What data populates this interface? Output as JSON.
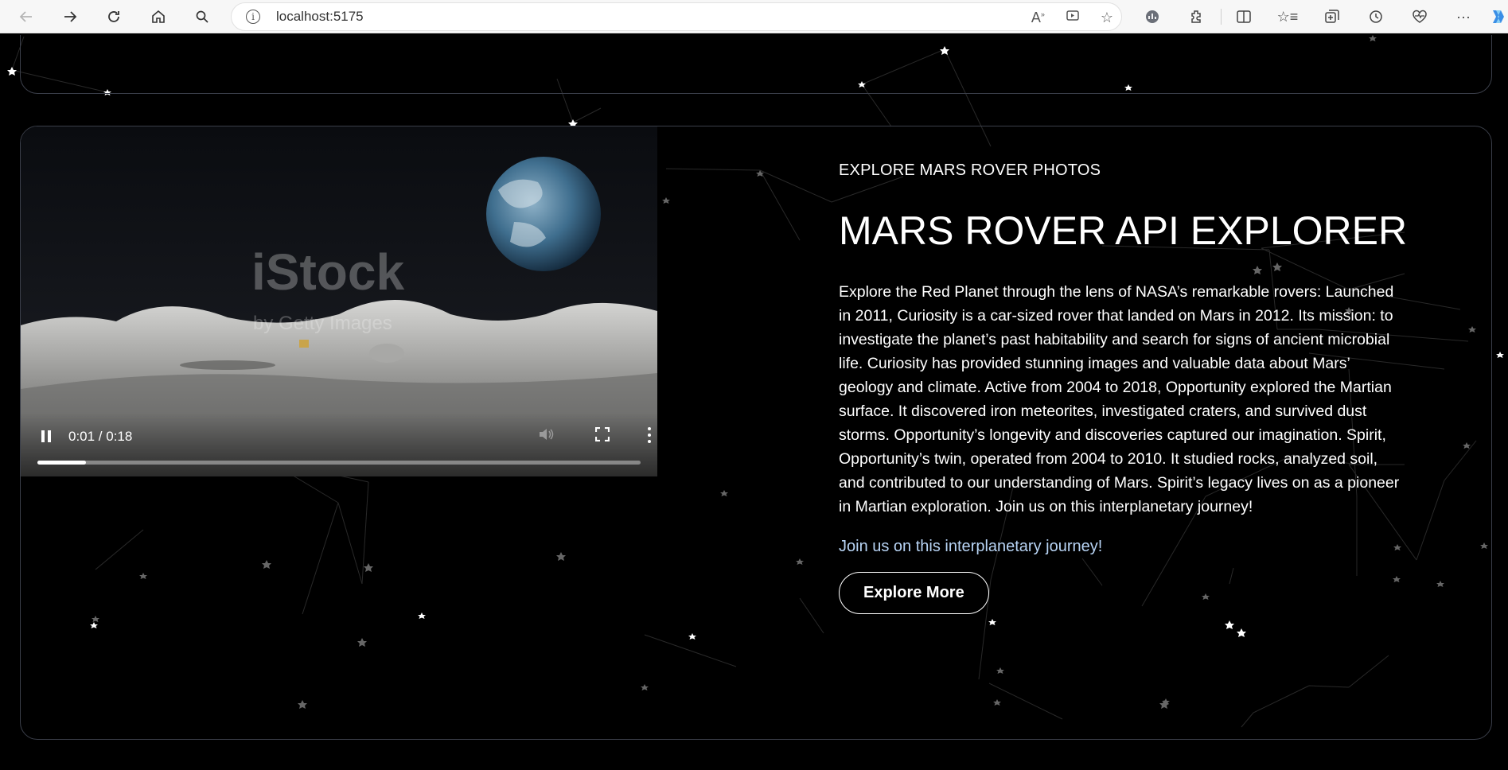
{
  "browser": {
    "url": "localhost:5175",
    "icons": [
      "back-icon",
      "forward-icon",
      "reload-icon",
      "home-icon",
      "search-icon",
      "site-info-icon",
      "read-aloud-icon",
      "immersive-reader-icon",
      "favorite-star-icon",
      "browser-essentials-icon",
      "extensions-icon",
      "split-screen-icon",
      "favorites-icon",
      "collections-icon",
      "history-icon",
      "performance-icon",
      "more-menu-icon",
      "copilot-icon"
    ]
  },
  "video": {
    "current_time": "0:01",
    "duration": "0:18",
    "time_display": "0:01 / 0:18",
    "progress": 0.08,
    "watermark": "iStock by Getty Images",
    "playing": true
  },
  "hero": {
    "eyebrow": "EXPLORE MARS ROVER PHOTOS",
    "title": "MARS ROVER API EXPLORER",
    "description": "Explore the Red Planet through the lens of NASA’s remarkable rovers: Launched in 2011, Curiosity is a car-sized rover that landed on Mars in 2012. Its mission: to investigate the planet’s past habitability and search for signs of ancient microbial life. Curiosity has provided stunning images and valuable data about Mars’ geology and climate. Active from 2004 to 2018, Opportunity explored the Martian surface. It discovered iron meteorites, investigated craters, and survived dust storms. Opportunity’s longevity and discoveries captured our imagination. Spirit, Opportunity’s twin, operated from 2004 to 2010. It studied rocks, analyzed soil, and contributed to our understanding of Mars. Spirit’s legacy lives on as a pioneer in Martian exploration. Join us on this interplanetary journey!",
    "tagline": "Join us on this interplanetary journey!",
    "cta_label": "Explore More"
  },
  "colors": {
    "background": "#000000",
    "card_border": "#3b3f4a",
    "tagline": "#b8d4f5",
    "text": "#ffffff"
  }
}
